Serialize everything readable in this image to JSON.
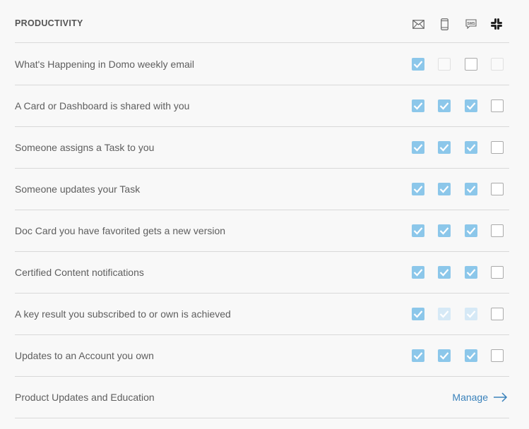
{
  "section": {
    "title": "PRODUCTIVITY",
    "columns": [
      {
        "icon": "email-icon"
      },
      {
        "icon": "mobile-icon"
      },
      {
        "icon": "sms-icon",
        "text": "SMS"
      },
      {
        "icon": "slack-icon"
      }
    ]
  },
  "rows": [
    {
      "label": "What's Happening in Domo weekly email",
      "checks": [
        "on",
        "off-disabled",
        "off",
        "off-disabled"
      ]
    },
    {
      "label": "A Card or Dashboard is shared with you",
      "checks": [
        "on",
        "on",
        "on",
        "off"
      ]
    },
    {
      "label": "Someone assigns a Task to you",
      "checks": [
        "on",
        "on",
        "on",
        "off"
      ]
    },
    {
      "label": "Someone updates your Task",
      "checks": [
        "on",
        "on",
        "on",
        "off"
      ]
    },
    {
      "label": "Doc Card you have favorited gets a new version",
      "checks": [
        "on",
        "on",
        "on",
        "off"
      ]
    },
    {
      "label": "Certified Content notifications",
      "checks": [
        "on",
        "on",
        "on",
        "off"
      ]
    },
    {
      "label": "A key result you subscribed to or own is achieved",
      "checks": [
        "on",
        "on-disabled",
        "on-disabled",
        "off"
      ]
    },
    {
      "label": "Updates to an Account you own",
      "checks": [
        "on",
        "on",
        "on",
        "off"
      ]
    }
  ],
  "footer": {
    "label": "Product Updates and Education",
    "manage_label": "Manage"
  },
  "colors": {
    "checked": "#8cc7ea",
    "checked_disabled": "#d6e9f6",
    "link": "#3a82bb"
  }
}
